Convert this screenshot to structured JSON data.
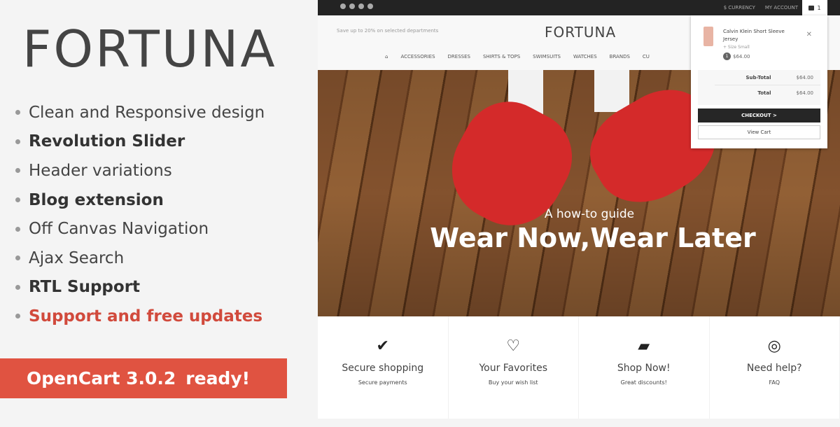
{
  "promo": {
    "title": "FORTUNA",
    "features": [
      {
        "label": "Clean and Responsive design",
        "style": "normal"
      },
      {
        "label": "Revolution Slider",
        "style": "bold"
      },
      {
        "label": "Header variations",
        "style": "normal"
      },
      {
        "label": "Blog extension",
        "style": "bold"
      },
      {
        "label": "Off Canvas Navigation",
        "style": "normal"
      },
      {
        "label": "Ajax Search",
        "style": "normal"
      },
      {
        "label": "RTL Support",
        "style": "bold"
      },
      {
        "label": "Support and free updates",
        "style": "red"
      }
    ],
    "banner_version": "OpenCart 3.0.2",
    "banner_ready": "ready!",
    "accent_color": "#e05341"
  },
  "site": {
    "topbar": {
      "social_icons": [
        "facebook-icon",
        "twitter-icon",
        "pinterest-icon",
        "instagram-icon"
      ],
      "currency": "$ CURRENCY",
      "account": "MY ACCOUNT",
      "cart_count": "1"
    },
    "header": {
      "promo_text": "Save up to 20% on selected departments",
      "logo": "FORTUNA",
      "nav": [
        "ACCESSORIES",
        "DRESSES",
        "SHIRTS & TOPS",
        "SWIMSUITS",
        "WATCHES",
        "BRANDS",
        "CU"
      ]
    },
    "hero": {
      "subtitle": "A how-to guide",
      "title": "Wear Now,Wear Later"
    },
    "features": [
      {
        "icon": "check-circle-icon",
        "title": "Secure shopping",
        "subtitle": "Secure payments"
      },
      {
        "icon": "heart-icon",
        "title": "Your Favorites",
        "subtitle": "Buy your wish list"
      },
      {
        "icon": "shopping-bag-icon",
        "title": "Shop Now!",
        "subtitle": "Great discounts!"
      },
      {
        "icon": "lifebuoy-icon",
        "title": "Need help?",
        "subtitle": "FAQ"
      }
    ],
    "cart": {
      "item_name": "Calvin Klein Short Sleeve Jersey",
      "item_option": "+ Size Small",
      "item_qty": "1",
      "item_price": "$64.00",
      "subtotal_label": "Sub-Total",
      "subtotal": "$64.00",
      "total_label": "Total",
      "total": "$64.00",
      "checkout": "CHECKOUT >",
      "view_cart": "View Cart"
    }
  }
}
